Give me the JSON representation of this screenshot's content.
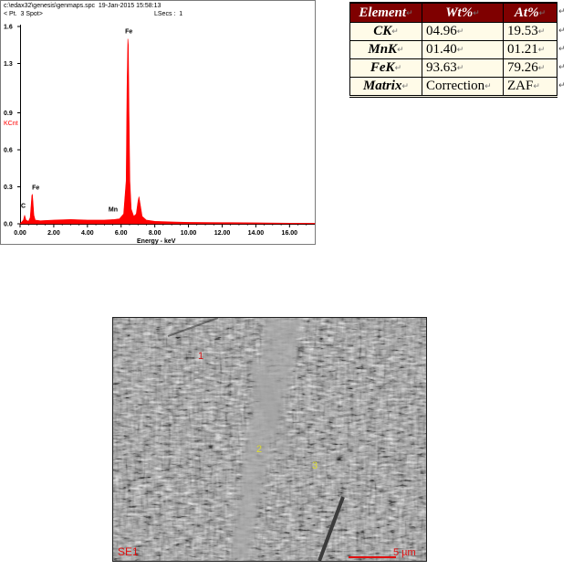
{
  "spectrum": {
    "header_line1": "c:\\edax32\\genesis\\genmaps.spc  19-Jan-2015 15:58:13",
    "header_line2": "< Pt.  3 Spot>",
    "header_lsecs": "LSecs :  1",
    "y_axis_label": "KCnt",
    "x_axis_label": "Energy - keV",
    "y_ticks": [
      "1.6",
      "1.3",
      "0.9",
      "0.6",
      "0.3",
      "0.0"
    ],
    "x_ticks": [
      "0.00",
      "2.00",
      "4.00",
      "6.00",
      "8.00",
      "10.00",
      "12.00",
      "14.00",
      "16.00"
    ],
    "peak_labels": [
      "C",
      "Fe",
      "Mn",
      "Fe"
    ],
    "colors": {
      "spectrum": "#ff0000",
      "axis_label": "#ff0000"
    }
  },
  "chart_data": {
    "type": "area",
    "title": "",
    "xlabel": "Energy - keV",
    "ylabel": "KCnt",
    "xlim": [
      0,
      17.5
    ],
    "ylim": [
      0,
      1.6
    ],
    "x": [
      0.0,
      0.2,
      0.27,
      0.35,
      0.5,
      0.6,
      0.65,
      0.7,
      0.73,
      0.76,
      0.82,
      0.9,
      1.2,
      2.0,
      3.0,
      4.0,
      5.0,
      5.6,
      5.9,
      6.15,
      6.3,
      6.35,
      6.4,
      6.43,
      6.47,
      6.52,
      6.6,
      6.75,
      6.9,
      7.0,
      7.06,
      7.12,
      7.25,
      7.5,
      8.0,
      9.0,
      10.0,
      12.0,
      14.0,
      16.0,
      17.5
    ],
    "y": [
      0.0,
      0.03,
      0.07,
      0.03,
      0.02,
      0.05,
      0.14,
      0.23,
      0.24,
      0.19,
      0.07,
      0.03,
      0.025,
      0.03,
      0.035,
      0.03,
      0.03,
      0.035,
      0.04,
      0.08,
      0.35,
      1.1,
      1.5,
      1.45,
      0.9,
      0.35,
      0.12,
      0.06,
      0.08,
      0.18,
      0.22,
      0.17,
      0.06,
      0.03,
      0.02,
      0.015,
      0.012,
      0.01,
      0.008,
      0.005,
      0.004
    ],
    "annotations": [
      {
        "label": "C",
        "x": 0.27,
        "y": 0.07
      },
      {
        "label": "Fe",
        "x": 0.71,
        "y": 0.24
      },
      {
        "label": "Mn",
        "x": 5.9,
        "y": 0.04
      },
      {
        "label": "Fe",
        "x": 6.4,
        "y": 1.5
      }
    ]
  },
  "table": {
    "headers": [
      "Element",
      "Wt%",
      "At%"
    ],
    "rows": [
      [
        "CK",
        "04.96",
        "19.53"
      ],
      [
        "MnK",
        "01.40",
        "01.21"
      ],
      [
        "FeK",
        "93.63",
        "79.26"
      ],
      [
        "Matrix",
        "Correction",
        "ZAF"
      ]
    ],
    "cell_mark": "↵"
  },
  "sem": {
    "markers": [
      "1",
      "2",
      "3"
    ],
    "detector_label": "SE1",
    "scale_label": "5 µm",
    "colors": {
      "marker_1": "#cc1111",
      "marker_2_3": "#dddd33",
      "overlay_text": "#e01010"
    }
  }
}
